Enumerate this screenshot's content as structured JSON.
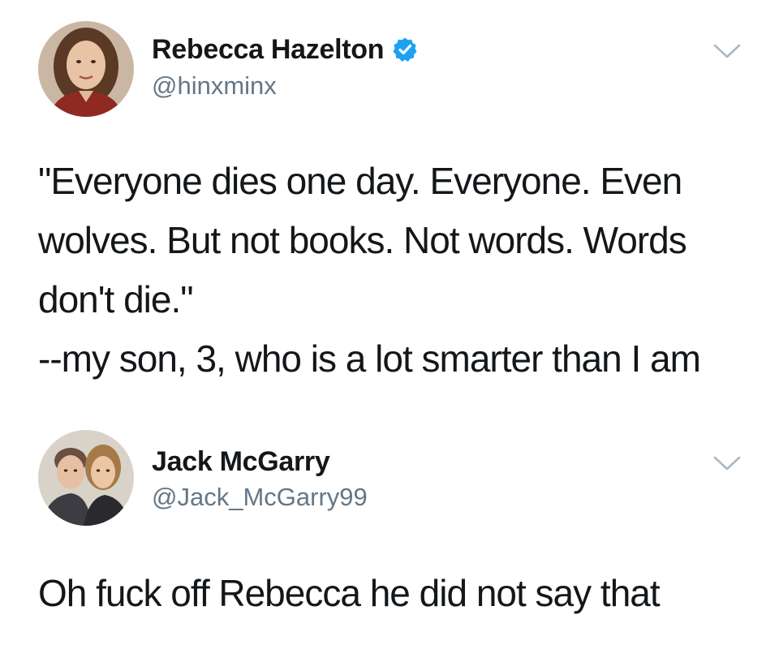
{
  "tweets": [
    {
      "display_name": "Rebecca Hazelton",
      "handle": "@hinxminx",
      "verified": true,
      "text_lines": [
        "\"Everyone dies one day. Everyone. Even",
        "wolves. But not books. Not words. Words",
        "don't die.\"",
        "--my son, 3, who is a lot smarter than I am"
      ]
    },
    {
      "display_name": "Jack McGarry",
      "handle": "@Jack_McGarry99",
      "verified": false,
      "text_lines": [
        "Oh fuck off Rebecca he did not say that"
      ]
    }
  ],
  "icons": {
    "verified": "verified-badge-icon",
    "menu": "chevron-down-icon"
  },
  "colors": {
    "text": "#14171a",
    "secondary": "#657786",
    "verified_blue": "#1da1f2",
    "chevron": "#aab8c2"
  }
}
